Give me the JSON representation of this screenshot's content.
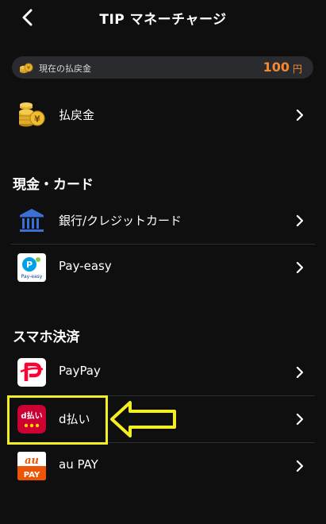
{
  "header": {
    "title": "TIP マネーチャージ"
  },
  "balance": {
    "label": "現在の払戻金",
    "amount": "100",
    "unit": "円"
  },
  "refund_row": {
    "label": "払戻金"
  },
  "section_cash": {
    "title": "現金・カード"
  },
  "bank_row": {
    "label": "銀行/クレジットカード"
  },
  "payeasy_row": {
    "label": "Pay-easy",
    "logo_text": "Pay-easy"
  },
  "section_mobile": {
    "title": "スマホ決済"
  },
  "paypay_row": {
    "label": "PayPay"
  },
  "dbarai_row": {
    "label": "d払い",
    "logo_text": "d払い"
  },
  "aupay_row": {
    "label": "au PAY",
    "logo_top": "au",
    "logo_bottom": "PAY"
  },
  "colors": {
    "background": "#0f0f10",
    "accent": "#f28a2e",
    "highlight": "#f4ef22",
    "paypay": "#ff0033",
    "dbarai": "#cc0033",
    "aupay": "#eb5505"
  },
  "icons": {
    "back": "chevron-left-icon",
    "coin": "coin-stack-icon",
    "bank": "bank-building-icon",
    "chevron": "chevron-right-icon"
  }
}
